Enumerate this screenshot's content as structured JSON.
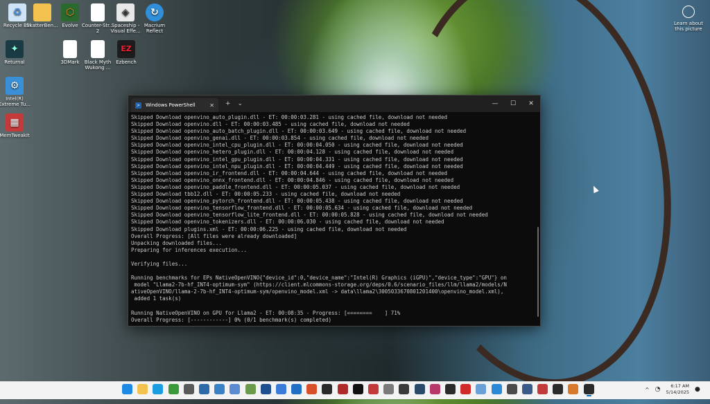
{
  "desktop": {
    "icons": [
      {
        "label": "Recycle Bin",
        "icon": "recycle-bin-icon",
        "color": "#4a90d9"
      },
      {
        "label": "SkatterBen...",
        "icon": "folder-icon",
        "color": "#f2c14e"
      },
      {
        "label": "Evolve",
        "icon": "evolve-app-icon",
        "color": "#2a6a2e"
      },
      {
        "label": "Counter-Str... 2",
        "icon": "document-icon",
        "color": "#ffffff"
      },
      {
        "label": "Spaceship - Visual Effe...",
        "icon": "unity-icon",
        "color": "#e8e8e8"
      },
      {
        "label": "Macrium Reflect",
        "icon": "macrium-icon",
        "color": "#2f8fd8"
      },
      {
        "label": "Returnal",
        "icon": "returnal-icon",
        "color": "#1b3b44"
      },
      {
        "label": "3DMark",
        "icon": "document-icon",
        "color": "#ffffff"
      },
      {
        "label": "Black Myth Wukong ...",
        "icon": "document-icon",
        "color": "#ffffff"
      },
      {
        "label": "Ezbench",
        "icon": "ezbench-icon",
        "color": "#1d1d1d"
      },
      {
        "label": "Intel(R) Extreme Tu...",
        "icon": "intel-xtu-icon",
        "color": "#3a8fd6"
      },
      {
        "label": "MemTweakIt",
        "icon": "memtweakit-icon",
        "color": "#c43a3a"
      }
    ],
    "learn": {
      "label": "Learn about this picture",
      "icon": "camera-icon"
    }
  },
  "window": {
    "tab_title": "Windows PowerShell",
    "new_tab": "+",
    "dropdown": "⌄",
    "close_tab": "✕",
    "minimize": "—",
    "maximize": "☐",
    "close": "✕"
  },
  "terminal": {
    "lines": [
      "Skipped Download openvino_auto_plugin.dll - ET: 00:00:03.281 - using cached file, download not needed",
      "Skipped Download openvino.dll - ET: 00:00:03.485 - using cached file, download not needed",
      "Skipped Download openvino_auto_batch_plugin.dll - ET: 00:00:03.649 - using cached file, download not needed",
      "Skipped Download openvino_genai.dll - ET: 00:00:03.854 - using cached file, download not needed",
      "Skipped Download openvino_intel_cpu_plugin.dll - ET: 00:00:04.050 - using cached file, download not needed",
      "Skipped Download openvino_hetero_plugin.dll - ET: 00:00:04.128 - using cached file, download not needed",
      "Skipped Download openvino_intel_gpu_plugin.dll - ET: 00:00:04.331 - using cached file, download not needed",
      "Skipped Download openvino_intel_npu_plugin.dll - ET: 00:00:04.449 - using cached file, download not needed",
      "Skipped Download openvino_ir_frontend.dll - ET: 00:00:04.644 - using cached file, download not needed",
      "Skipped Download openvino_onnx_frontend.dll - ET: 00:00:04.846 - using cached file, download not needed",
      "Skipped Download openvino_paddle_frontend.dll - ET: 00:00:05.037 - using cached file, download not needed",
      "Skipped Download tbb12.dll - ET: 00:00:05.233 - using cached file, download not needed",
      "Skipped Download openvino_pytorch_frontend.dll - ET: 00:00:05.438 - using cached file, download not needed",
      "Skipped Download openvino_tensorflow_frontend.dll - ET: 00:00:05.634 - using cached file, download not needed",
      "Skipped Download openvino_tensorflow_lite_frontend.dll - ET: 00:00:05.828 - using cached file, download not needed",
      "Skipped Download openvino_tokenizers.dll - ET: 00:00:06.030 - using cached file, download not needed",
      "Skipped Download plugins.xml - ET: 00:00:06.225 - using cached file, download not needed",
      "Overall Progress: [All files were already downloaded]",
      "Unpacking downloaded files...",
      "Preparing for inferences execution...",
      "",
      "Verifying files...",
      "",
      "Running benchmarks for EPs NativeOpenVINO{\"device_id\":0,\"device_name\":\"Intel(R) Graphics (iGPU)\",\"device_type\":\"GPU\"} on",
      " model \"Llama2-7b-hf_INT4-optimum-sym\" (https://client.mlcommons-storage.org/deps/0.6/scenario_files/llm/llama2/models/N",
      "ativeOpenVINO/llama-2-7b-hf_INT4-optimum-sym/openvino_model.xml -> data\\llama2\\3005033670801201400\\openvino_model.xml),",
      " added 1 task(s)",
      "",
      "Running NativeOpenVINO on GPU for Llama2 - ET: 00:08:35 - Progress: [========    ] 71%",
      "Overall Progress: [------------] 0% (0/1 benchmark(s) completed)"
    ]
  },
  "taskbar": {
    "apps": [
      {
        "icon": "start-windows-icon",
        "color": "#1e88e5"
      },
      {
        "icon": "file-explorer-icon",
        "color": "#f2c14e"
      },
      {
        "icon": "edge-browser-icon",
        "color": "#1b9de2"
      },
      {
        "icon": "cpu-z-icon",
        "color": "#3a9a3a"
      },
      {
        "icon": "nvidia-app-icon",
        "color": "#5a5a5a"
      },
      {
        "icon": "gpu-z-icon",
        "color": "#2d6aa8"
      },
      {
        "icon": "hwinfo-icon",
        "color": "#3b82c4"
      },
      {
        "icon": "chart-app-icon",
        "color": "#5a8ad0"
      },
      {
        "icon": "network-app-icon",
        "color": "#6a9a4a"
      },
      {
        "icon": "aida-icon",
        "color": "#1f4f8f"
      },
      {
        "icon": "settings-app-icon",
        "color": "#3a7ad8"
      },
      {
        "icon": "microsoft-store-icon",
        "color": "#1f6fc4"
      },
      {
        "icon": "flame-app-icon",
        "color": "#d8502a"
      },
      {
        "icon": "steam-icon",
        "color": "#2a2a2a"
      },
      {
        "icon": "cinebench-icon",
        "color": "#b02a2a"
      },
      {
        "icon": "c-app-icon",
        "color": "#111111"
      },
      {
        "icon": "benchmark-app-icon",
        "color": "#c23a3a"
      },
      {
        "icon": "dx-app-icon",
        "color": "#7a7a7a"
      },
      {
        "icon": "terminal-app-icon",
        "color": "#3a3a3a"
      },
      {
        "icon": "monitor-app-icon",
        "color": "#2a4a6a"
      },
      {
        "icon": "hexagon-app-icon",
        "color": "#b8386a"
      },
      {
        "icon": "bm-app-icon",
        "color": "#2a2a2a"
      },
      {
        "icon": "red-app-icon",
        "color": "#d02a2a"
      },
      {
        "icon": "window-app-icon",
        "color": "#6aa0d8"
      },
      {
        "icon": "blue-app-icon",
        "color": "#2a8ad8"
      },
      {
        "icon": "star-app-icon",
        "color": "#4a4a4a"
      },
      {
        "icon": "graph-app-icon",
        "color": "#3a5a8a"
      },
      {
        "icon": "ra-app-icon",
        "color": "#c23a3a"
      },
      {
        "icon": "bm2-app-icon",
        "color": "#2a2a2a"
      },
      {
        "icon": "snip-app-icon",
        "color": "#d8782a"
      },
      {
        "icon": "powershell-icon",
        "color": "#2a2a2a",
        "active": true
      }
    ],
    "tray_chevron": "^",
    "time": "6:17 AM",
    "date": "5/14/2025"
  }
}
